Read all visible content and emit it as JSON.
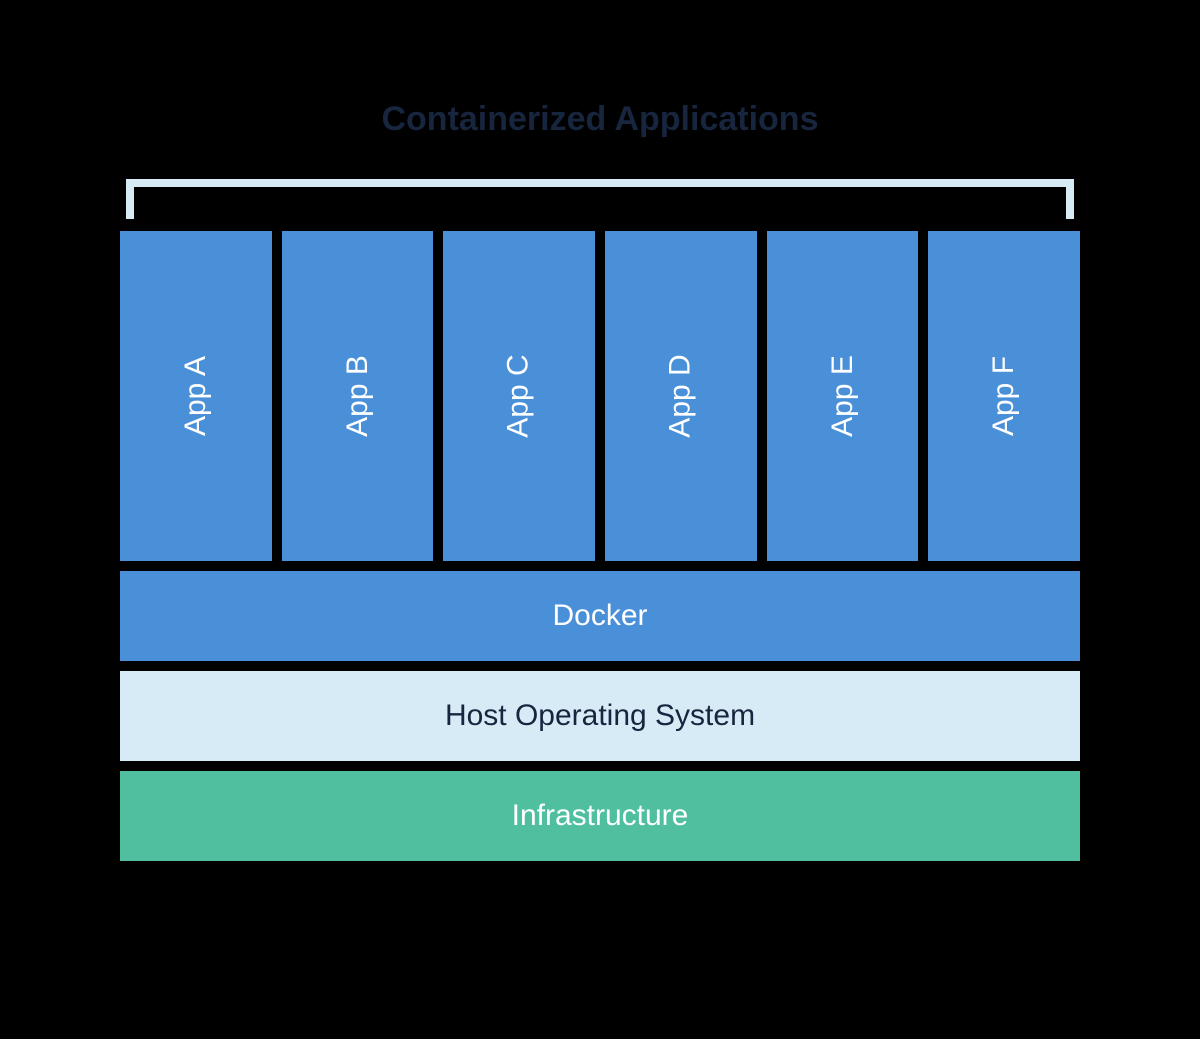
{
  "title": "Containerized Applications",
  "apps": [
    "App A",
    "App B",
    "App C",
    "App D",
    "App E",
    "App F"
  ],
  "layers": {
    "docker": "Docker",
    "host": "Host Operating System",
    "infrastructure": "Infrastructure"
  },
  "colors": {
    "app_box": "#4a90d9",
    "bracket": "#d7ebf7",
    "host_bg": "#d7ebf7",
    "infra_bg": "#4fbfa0",
    "title_text": "#17253e"
  }
}
